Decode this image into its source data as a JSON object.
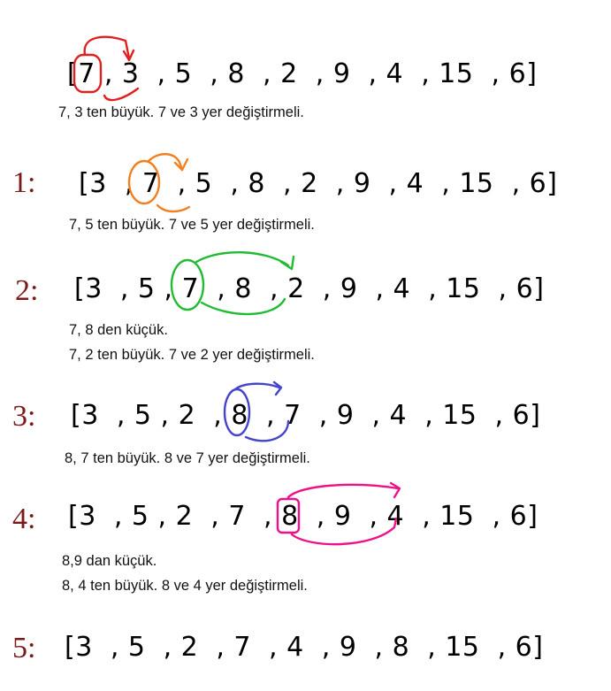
{
  "colors": {
    "step_label": "#7a1a1a",
    "red": "#e02020",
    "orange": "#f08020",
    "green": "#22bb33",
    "blue": "#4444cc",
    "pink": "#ee1188"
  },
  "rows": [
    {
      "step": "",
      "array": "[7 , 3  , 5  , 8  , 2  , 9  , 4  , 15  , 6]",
      "notes": [
        "7, 3 ten büyük. 7 ve 3 yer değiştirmeli."
      ]
    },
    {
      "step": "1:",
      "array": "[3  , 7  , 5  , 8  , 2  , 9  , 4  , 15  , 6]",
      "notes": [
        "7, 5 ten büyük. 7 ve 5 yer değiştirmeli."
      ]
    },
    {
      "step": "2:",
      "array": "[3  , 5 , 7  , 8  , 2  , 9  , 4  , 15  , 6]",
      "notes": [
        "7, 8 den küçük.",
        "7, 2 ten büyük. 7 ve 2 yer değiştirmeli."
      ]
    },
    {
      "step": "3:",
      "array": "[3  , 5 , 2  , 8  , 7  , 9  , 4  , 15  , 6]",
      "notes": [
        "8, 7 ten büyük. 8 ve 7 yer değiştirmeli."
      ]
    },
    {
      "step": "4:",
      "array": "[3  , 5 , 2  , 7  , 8  , 9  , 4  , 15  , 6]",
      "notes": [
        "8,9 dan küçük.",
        "8, 4 ten büyük. 8 ve 4 yer değiştirmeli."
      ]
    },
    {
      "step": "5:",
      "array": "[3  , 5  , 2  , 7  , 4  , 9  , 8  , 15  , 6]",
      "notes": []
    }
  ]
}
